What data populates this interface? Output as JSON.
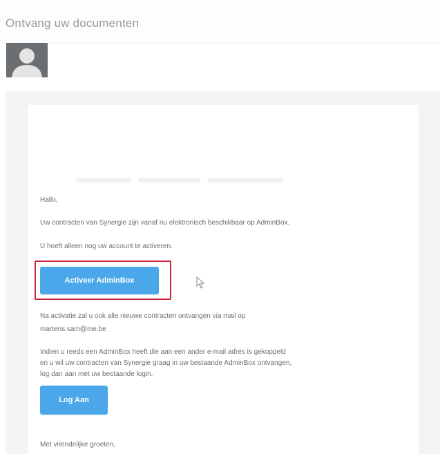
{
  "email": {
    "subject": "Ontvang uw documenten",
    "greeting": "Hallo,",
    "intro": "Uw contracten van Synergie zijn vanaf nu elektronisch beschikbaar op AdminBox.",
    "action_hint": "U hoeft alleen nog uw account te activeren.",
    "activate_button": "Activeer AdminBox",
    "after_activation_line1": "Na activatie zal u ook alle nieuwe contracten ontvangen via mail op",
    "after_activation_email": "martens.sam@me.be",
    "existing_line1": "Indien u reeds een AdminBox heeft die aan een ander e-mail adres is gekoppeld",
    "existing_line2": "en u wil uw contracten van Synergie graag in uw bestaande AdminBox ontvangen,",
    "existing_line3": "log dan aan met uw bestaande login.",
    "login_button": "Log Aan",
    "closing": "Met vriendelijke groeten,"
  },
  "colors": {
    "button_blue": "#4aa8ea",
    "highlight_red": "#c8253a"
  }
}
